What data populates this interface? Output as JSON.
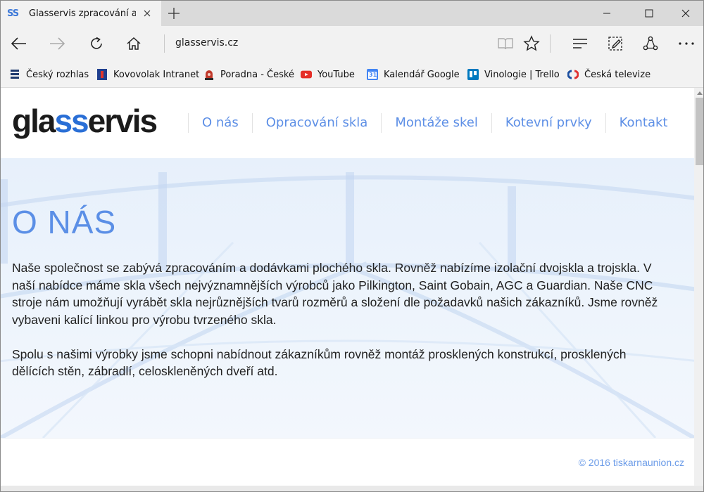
{
  "browser": {
    "tab": {
      "favicon": "SS",
      "title": "Glasservis zpracování a",
      "close_icon": "close-icon"
    },
    "address": "glasservis.cz",
    "favorites": [
      {
        "label": "Český rozhlas",
        "icon": "cesky-rozhlas-icon"
      },
      {
        "label": "Kovovolak Intranet",
        "icon": "kovovolak-icon"
      },
      {
        "label": "Poradna - České",
        "icon": "poradna-icon"
      },
      {
        "label": "YouTube",
        "icon": "youtube-icon"
      },
      {
        "label": "Kalendář Google",
        "icon": "calendar-icon",
        "icon_text": "31"
      },
      {
        "label": "Vinologie | Trello",
        "icon": "trello-icon"
      },
      {
        "label": "Česká televize",
        "icon": "ceska-televize-icon"
      }
    ]
  },
  "site": {
    "logo": {
      "part1": "gla",
      "part2": "ss",
      "part3": "ervis"
    },
    "menu": [
      "O nás",
      "Opracování skla",
      "Montáže skel",
      "Kotevní prvky",
      "Kontakt"
    ],
    "hero": {
      "title": "O NÁS",
      "paragraphs": [
        "Naše společnost se zabývá zpracováním a dodávkami plochého skla. Rovněž nabízíme izolační dvojskla a trojskla. V naší nabídce máme skla všech nejvýznamnějších výrobců jako Pilkington, Saint Gobain, AGC a Guardian. Naše CNC stroje nám umožňují vyrábět skla nejrůznějších tvarů rozměrů a složení dle požadavků našich zákazníků. Jsme rovněž vybaveni kalící linkou pro výrobu tvrzeného skla.",
        "Spolu s našimi výrobky jsme schopni nabídnout zákazníkům rovněž montáž prosklených konstrukcí, prosklených dělících stěn, zábradlí, celoskleněných dveří atd."
      ]
    },
    "footer": {
      "copyright": "© 2016 tiskarnaunion.cz"
    }
  },
  "colors": {
    "accent": "#5b8fe6",
    "logo_dark": "#1b1b1b",
    "logo_blue": "#2a6fd6"
  }
}
